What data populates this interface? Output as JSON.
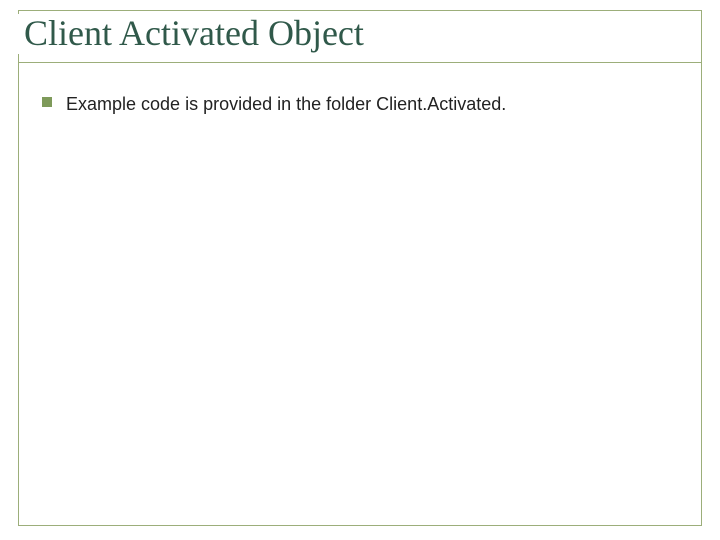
{
  "colors": {
    "border": "#9cae7a",
    "title": "#30594a",
    "bullet": "#7e9a5a",
    "text": "#222222"
  },
  "slide": {
    "title": "Client Activated Object",
    "bullets": [
      {
        "text": "Example code is provided in the folder Client.Activated."
      }
    ]
  }
}
